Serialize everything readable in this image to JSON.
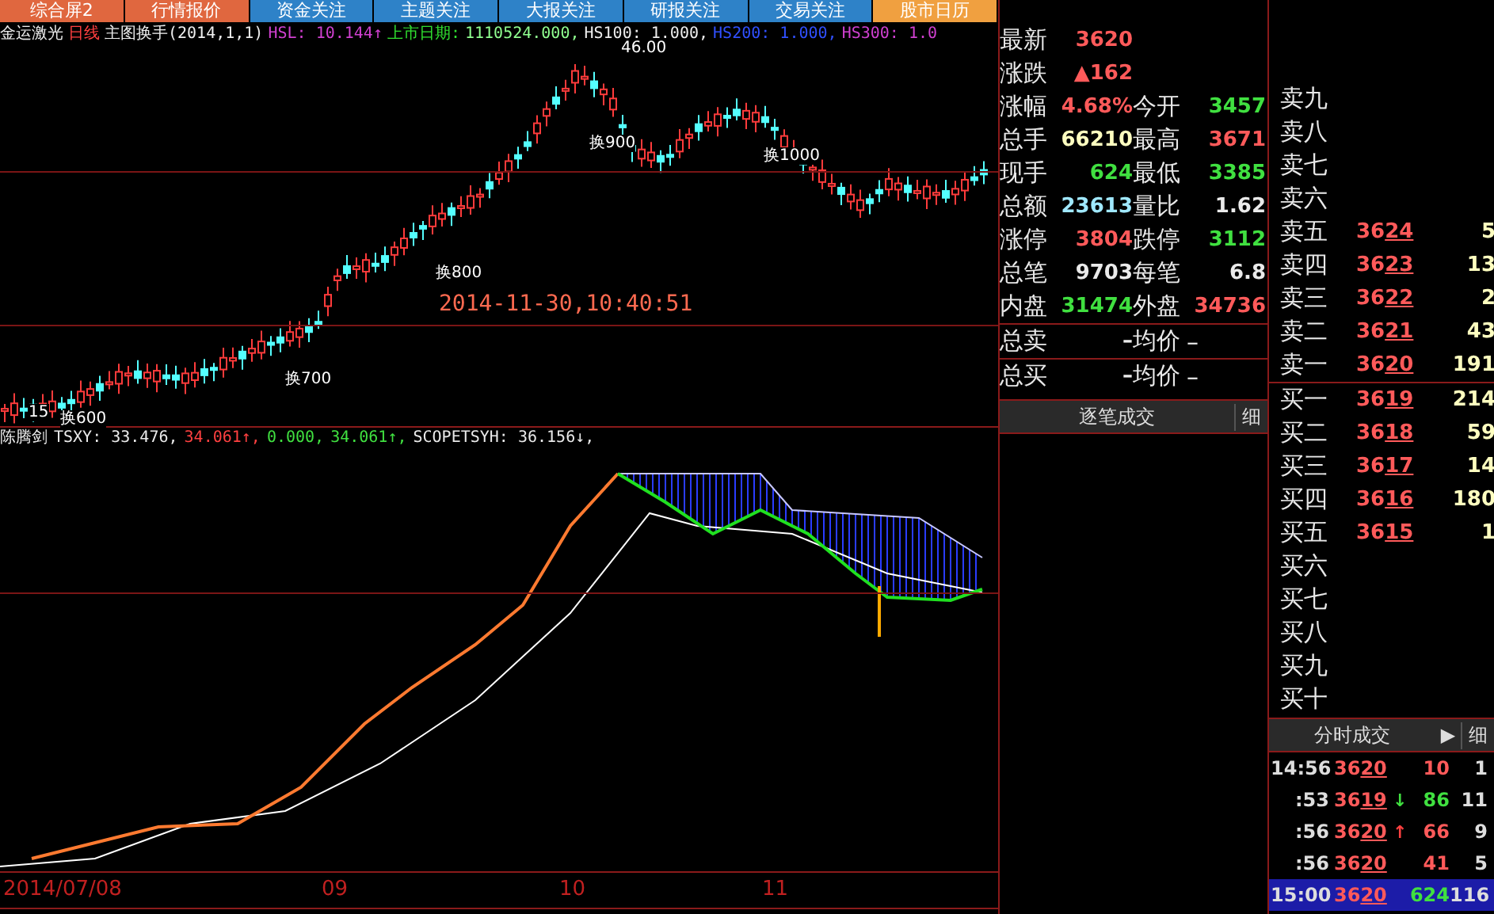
{
  "top_tabs": [
    {
      "label": "综合屏2",
      "kind": "warm"
    },
    {
      "label": "行情报价",
      "kind": "warm"
    },
    {
      "label": "资金关注",
      "kind": "cool"
    },
    {
      "label": "主题关注",
      "kind": "cool"
    },
    {
      "label": "大报关注",
      "kind": "cool"
    },
    {
      "label": "研报关注",
      "kind": "cool"
    },
    {
      "label": "交易关注",
      "kind": "cool"
    },
    {
      "label": "股市日历",
      "kind": "gold"
    }
  ],
  "chart_header": {
    "stock": "金运激光",
    "period": "日线",
    "indicator": "主图换手(2014,1,1)",
    "hsl": "HSL: 10.144↑",
    "listing_label": "上市日期:",
    "listing_value": "1110524.000,",
    "hs100": "HS100: 1.000,",
    "hs200": "HS200: 1.000,",
    "hs300": "HS300: 1.0"
  },
  "price_chart": {
    "peak_label": "46.00",
    "timestamp": "2014-11-30,10:40:51",
    "turnover_marks": [
      "换600",
      "换700",
      "换800",
      "换900",
      "换1000"
    ],
    "low_label": "15"
  },
  "indicator": {
    "name": "陈腾剑",
    "segments": [
      {
        "text": "TSXY: 33.476,",
        "kind": "plain"
      },
      {
        "text": "34.061↑,",
        "kind": "up"
      },
      {
        "text": "0.000,",
        "kind": "down"
      },
      {
        "text": "34.061↑,",
        "kind": "down"
      },
      {
        "text": "SCOPETSYH: 36.156↓,",
        "kind": "plain"
      }
    ]
  },
  "x_axis": [
    "2014/07/08",
    "09",
    "10",
    "11"
  ],
  "quote": [
    {
      "cells": [
        {
          "label": "最新",
          "value": "3620",
          "kind": "up"
        }
      ]
    },
    {
      "cells": [
        {
          "label": "涨跌",
          "value": "▲162",
          "kind": "up"
        }
      ]
    },
    {
      "cells": [
        {
          "label": "涨幅",
          "value": "4.68%",
          "kind": "up"
        },
        {
          "label": "今开",
          "value": "3457",
          "kind": "down"
        }
      ]
    },
    {
      "cells": [
        {
          "label": "总手",
          "value": "66210",
          "kind": "volume"
        },
        {
          "label": "最高",
          "value": "3671",
          "kind": "up"
        }
      ]
    },
    {
      "cells": [
        {
          "label": "现手",
          "value": "624",
          "kind": "down"
        },
        {
          "label": "最低",
          "value": "3385",
          "kind": "down"
        }
      ]
    },
    {
      "cells": [
        {
          "label": "总额",
          "value": "23613",
          "kind": "amount"
        },
        {
          "label": "量比",
          "value": "1.62",
          "kind": "flat"
        }
      ]
    },
    {
      "cells": [
        {
          "label": "涨停",
          "value": "3804",
          "kind": "up"
        },
        {
          "label": "跌停",
          "value": "3112",
          "kind": "down"
        }
      ]
    },
    {
      "cells": [
        {
          "label": "总笔",
          "value": "9703",
          "kind": "flat"
        },
        {
          "label": "每笔",
          "value": "6.8",
          "kind": "flat"
        }
      ]
    },
    {
      "cells": [
        {
          "label": "内盘",
          "value": "31474",
          "kind": "down"
        },
        {
          "label": "外盘",
          "value": "34736",
          "kind": "up"
        }
      ]
    }
  ],
  "totals": [
    {
      "label": "总卖",
      "value": "–",
      "label2": "均价",
      "value2": "–"
    },
    {
      "label": "总买",
      "value": "–",
      "label2": "均价",
      "value2": "–"
    }
  ],
  "tick_bar": {
    "title": "逐笔成交",
    "detail": "细"
  },
  "sells": [
    {
      "label": "卖九"
    },
    {
      "label": "卖八"
    },
    {
      "label": "卖七"
    },
    {
      "label": "卖六"
    },
    {
      "label": "卖五",
      "price": "3624",
      "volume": "5"
    },
    {
      "label": "卖四",
      "price": "3623",
      "volume": "13"
    },
    {
      "label": "卖三",
      "price": "3622",
      "volume": "2"
    },
    {
      "label": "卖二",
      "price": "3621",
      "volume": "43"
    },
    {
      "label": "卖一",
      "price": "3620",
      "volume": "191"
    }
  ],
  "buys": [
    {
      "label": "买一",
      "price": "3619",
      "volume": "214"
    },
    {
      "label": "买二",
      "price": "3618",
      "volume": "59"
    },
    {
      "label": "买三",
      "price": "3617",
      "volume": "14"
    },
    {
      "label": "买四",
      "price": "3616",
      "volume": "180"
    },
    {
      "label": "买五",
      "price": "3615",
      "volume": "1"
    },
    {
      "label": "买六"
    },
    {
      "label": "买七"
    },
    {
      "label": "买八"
    },
    {
      "label": "买九"
    },
    {
      "label": "买十"
    }
  ],
  "trade_bar": {
    "title": "分时成交",
    "arrow": "▶",
    "detail": "细"
  },
  "trades": [
    {
      "time": "14:56",
      "price": "3620",
      "volume": "10",
      "kind": "buy",
      "count": "1",
      "selected": false
    },
    {
      "time": ":53",
      "price": "3619",
      "arrow": "↓",
      "volume": "86",
      "kind": "sell",
      "count": "11",
      "selected": false
    },
    {
      "time": ":56",
      "price": "3620",
      "arrow": "↑",
      "volume": "66",
      "kind": "buy",
      "count": "9",
      "selected": false
    },
    {
      "time": ":56",
      "price": "3620",
      "volume": "41",
      "kind": "buy",
      "count": "5",
      "selected": false
    },
    {
      "time": "15:00",
      "price": "3620",
      "volume": "624",
      "kind": "sell",
      "count": "116",
      "selected": true
    }
  ]
}
